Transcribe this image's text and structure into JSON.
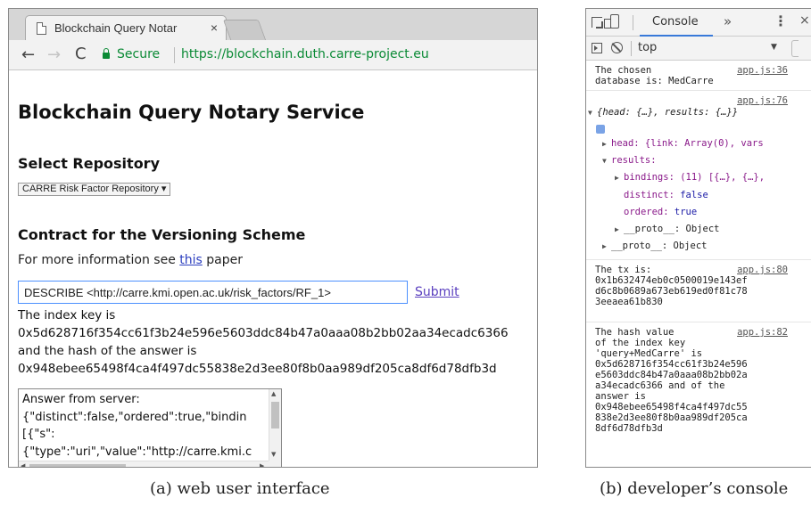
{
  "browser": {
    "tab_title": "Blockchain Query Notar",
    "tab_close": "×",
    "secure_label": "Secure",
    "url": "https://blockchain.duth.carre-project.eu",
    "back": "←",
    "forward": "→",
    "reload": "C"
  },
  "page": {
    "title": "Blockchain Query Notary Service",
    "select_repo_heading": "Select Repository",
    "repo_select_value": "CARRE Risk Factor Repository ▾",
    "contract_heading": "Contract for the Versioning Scheme",
    "more_info_prefix": "For more information see ",
    "more_info_link": "this",
    "more_info_suffix": " paper",
    "query_value": "DESCRIBE <http://carre.kmi.open.ac.uk/risk_factors/RF_1>",
    "submit_label": "Submit",
    "result_lines": [
      "The index key is",
      "0x5d628716f354cc61f3b24e596e5603ddc84b47a0aaa08b2bb02aa34ecadc6366",
      "and the hash of the answer is",
      "0x948ebee65498f4ca4f497dc55838e2d3ee80f8b0aa989df205ca8df6d78dfb3d"
    ],
    "answer_lines": [
      "Answer from server:",
      "{\"distinct\":false,\"ordered\":true,\"bindin",
      "[{\"s\":",
      "{\"type\":\"uri\",\"value\":\"http://carre.kmi.c"
    ]
  },
  "devtools": {
    "console_tab": "Console",
    "more_tabs": "»",
    "menu": "⋮",
    "close": "×",
    "context": "top",
    "messages": {
      "m1": {
        "line1": "The chosen",
        "line2": "database is: MedCarre",
        "source": "app.js:36"
      },
      "m2": {
        "source": "app.js:76",
        "summary": "{head: {…}, results: {…}}",
        "head": "head: {link: Array(0), vars",
        "results": "results:",
        "bindings": "bindings: (11) [{…}, {…},",
        "distinct_key": "distinct: ",
        "distinct_val": "false",
        "ordered_key": "ordered: ",
        "ordered_val": "true",
        "proto_inner": "__proto__: Object",
        "proto_outer": "__proto__: Object"
      },
      "m3": {
        "source": "app.js:80",
        "lines": [
          "The tx is:",
          "0x1b632474eb0c0500019e143ef",
          "d6c8b0689a673eb619ed0f81c78",
          "3eeaea61b830"
        ]
      },
      "m4": {
        "source": "app.js:82",
        "lines": [
          "The hash value",
          "of the index key",
          "'query+MedCarre' is",
          "0x5d628716f354cc61f3b24e596",
          "e5603ddc84b47a0aaa08b2bb02a",
          "a34ecadc6366 and of the",
          "answer is",
          "0x948ebee65498f4ca4f497dc55",
          "838e2d3ee80f8b0aa989df205ca",
          "8df6d78dfb3d"
        ]
      }
    }
  },
  "captions": {
    "left": "(a) web user interface",
    "right": "(b) developer’s console"
  }
}
